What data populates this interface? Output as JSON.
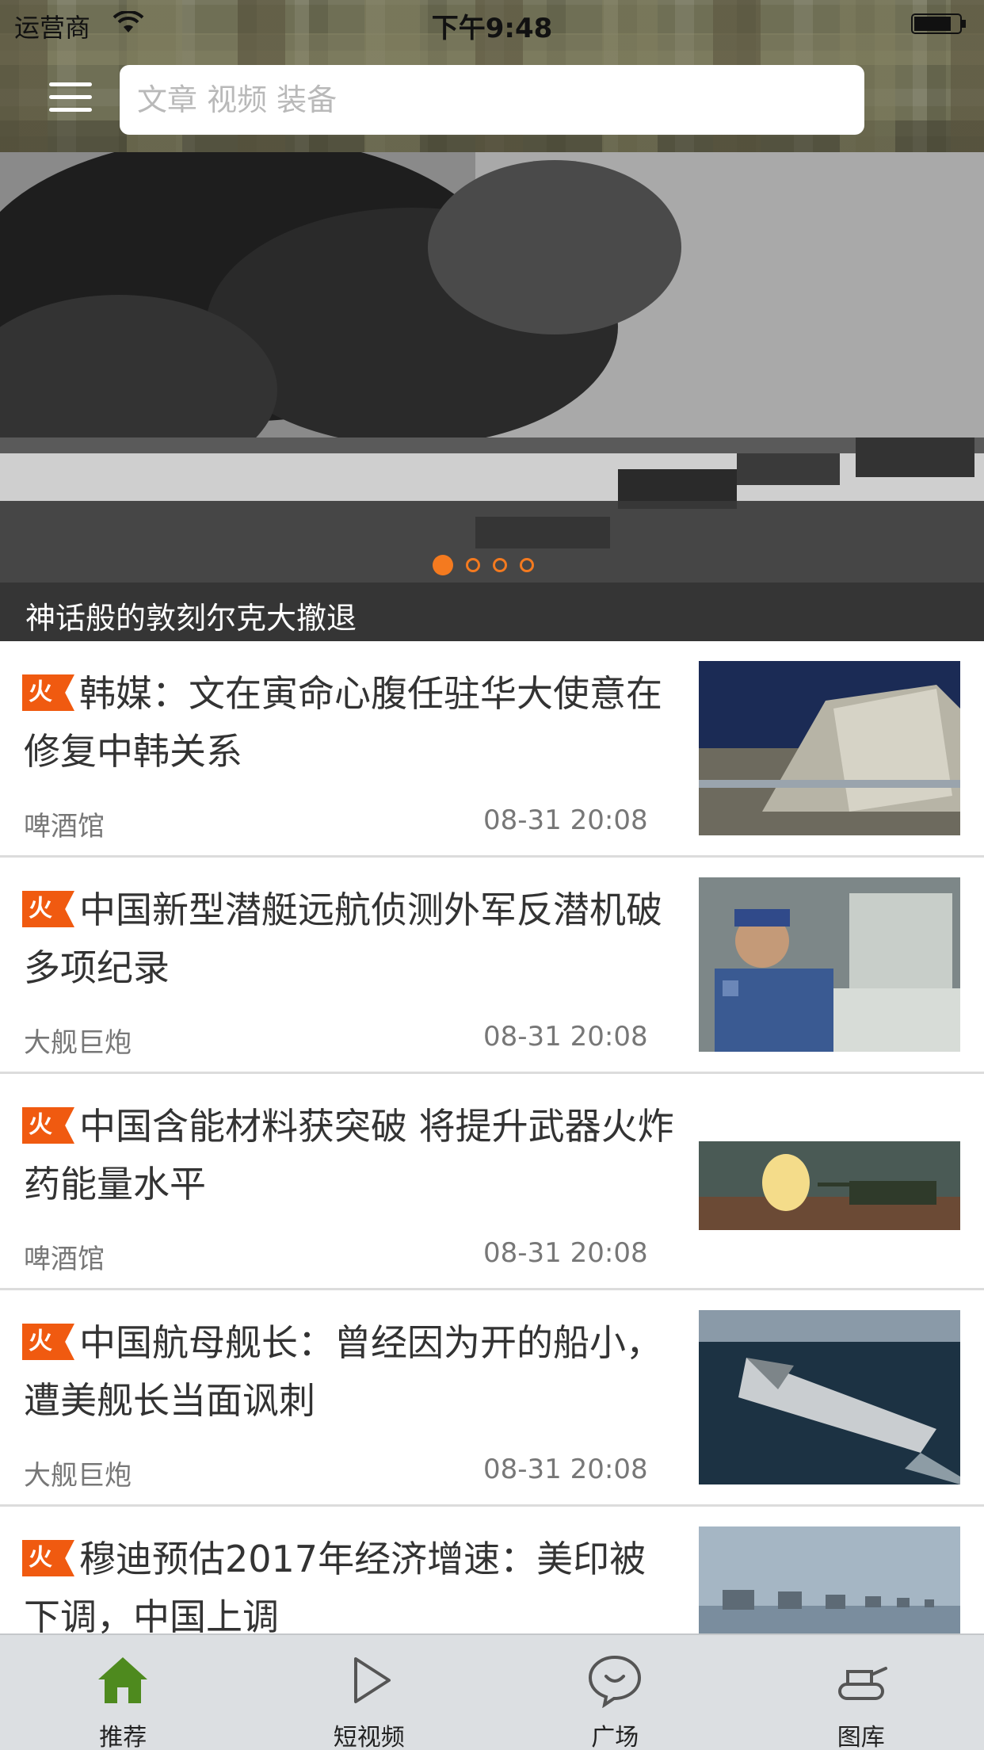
{
  "status_bar": {
    "carrier": "运营商",
    "time": "下午9:48"
  },
  "search": {
    "placeholder": "文章 视频 装备"
  },
  "banner": {
    "caption": "神话般的敦刻尔克大撤退",
    "dot_count": 4,
    "active_dot": 0
  },
  "news": [
    {
      "badge": "火",
      "title": "韩媒：文在寅命心腹任驻华大使意在修复中韩关系",
      "source": "啤酒馆",
      "time": "08-31 20:08",
      "thumb_icon": "radar-photo"
    },
    {
      "badge": "火",
      "title": "中国新型潜艇远航侦测外军反潜机破多项纪录",
      "source": "大舰巨炮",
      "time": "08-31 20:08",
      "thumb_icon": "submarine-crew-photo"
    },
    {
      "badge": "火",
      "title": "中国含能材料获突破 将提升武器火炸药能量水平",
      "source": "啤酒馆",
      "time": "08-31 20:08",
      "thumb_icon": "tank-firing-photo"
    },
    {
      "badge": "火",
      "title": "中国航母舰长：曾经因为开的船小，遭美舰长当面讽刺",
      "source": "大舰巨炮",
      "time": "08-31 20:08",
      "thumb_icon": "aircraft-carrier-photo"
    },
    {
      "badge": "火",
      "title": "穆迪预估2017年经济增速：美印被下调，中国上调",
      "source": "",
      "time": "",
      "thumb_icon": "fleet-photo"
    }
  ],
  "tabs": [
    {
      "label": "推荐",
      "icon": "home-icon",
      "active": true
    },
    {
      "label": "短视频",
      "icon": "play-icon",
      "active": false
    },
    {
      "label": "广场",
      "icon": "chat-bubble-icon",
      "active": false
    },
    {
      "label": "图库",
      "icon": "tank-icon",
      "active": false
    }
  ],
  "colors": {
    "accent": "#f47a1f",
    "hot_badge": "#f05a10",
    "home_tab": "#4e8a1e",
    "tab_bar": "#dcdfe2"
  }
}
